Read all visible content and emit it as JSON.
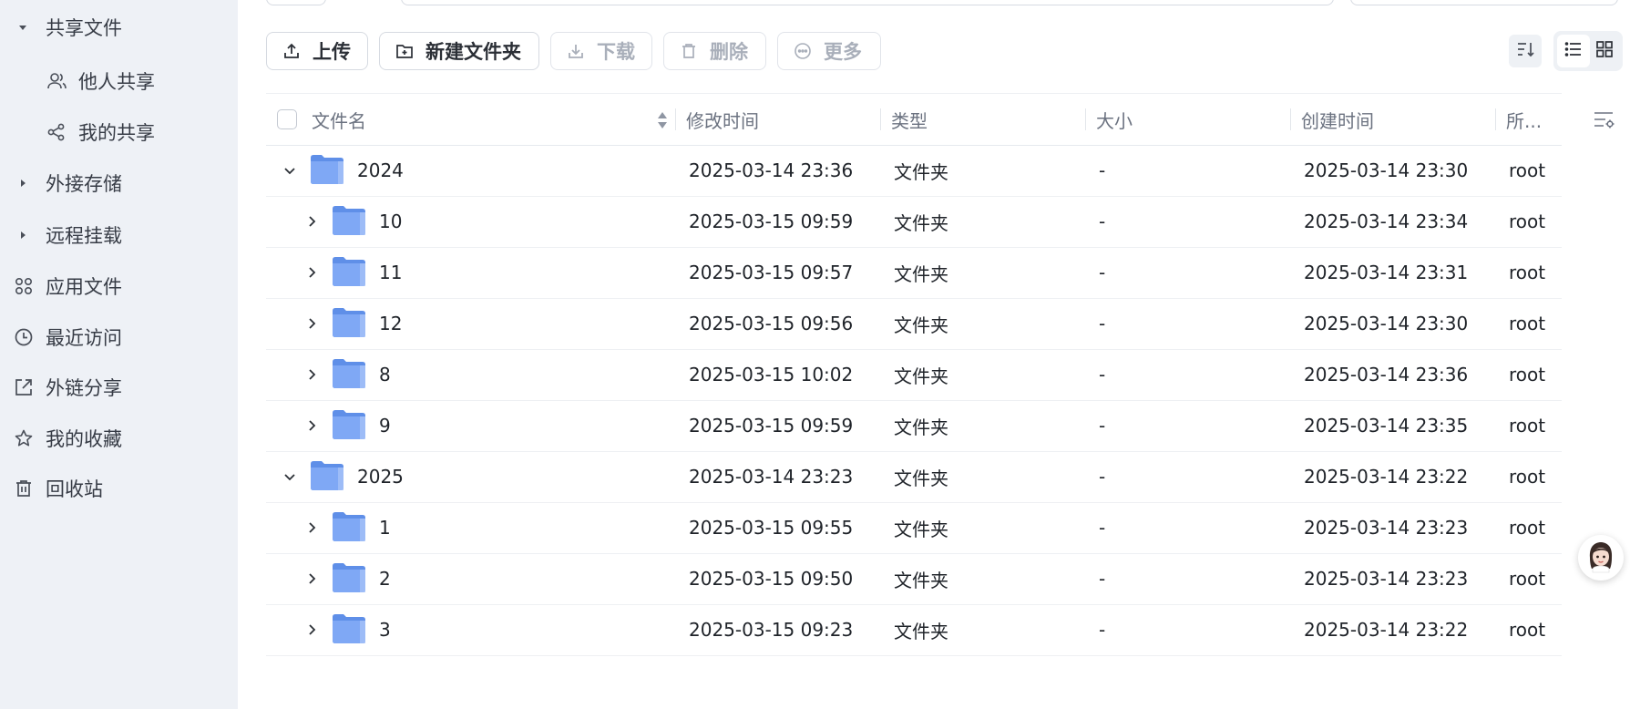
{
  "sidebar": {
    "items": [
      {
        "label": "共享文件",
        "kind": "group-open"
      },
      {
        "label": "他人共享",
        "kind": "sub",
        "icon": "users-icon"
      },
      {
        "label": "我的共享",
        "kind": "sub",
        "icon": "share-icon"
      },
      {
        "label": "外接存储",
        "kind": "group-closed"
      },
      {
        "label": "远程挂载",
        "kind": "group-closed"
      },
      {
        "label": "应用文件",
        "kind": "item",
        "icon": "apps-icon"
      },
      {
        "label": "最近访问",
        "kind": "item",
        "icon": "clock-icon"
      },
      {
        "label": "外链分享",
        "kind": "item",
        "icon": "external-link-icon"
      },
      {
        "label": "我的收藏",
        "kind": "item",
        "icon": "star-icon"
      },
      {
        "label": "回收站",
        "kind": "item",
        "icon": "trash-icon"
      }
    ]
  },
  "toolbar": {
    "upload": "上传",
    "new_folder": "新建文件夹",
    "download": "下载",
    "delete": "删除",
    "more": "更多"
  },
  "table": {
    "headers": {
      "name": "文件名",
      "modified": "修改时间",
      "type": "类型",
      "size": "大小",
      "created": "创建时间",
      "owner": "所..."
    },
    "rows": [
      {
        "level": 0,
        "expanded": true,
        "name": "2024",
        "modified": "2025-03-14 23:36",
        "type": "文件夹",
        "size": "-",
        "created": "2025-03-14 23:30",
        "owner": "root"
      },
      {
        "level": 1,
        "expanded": false,
        "name": "10",
        "modified": "2025-03-15 09:59",
        "type": "文件夹",
        "size": "-",
        "created": "2025-03-14 23:34",
        "owner": "root"
      },
      {
        "level": 1,
        "expanded": false,
        "name": "11",
        "modified": "2025-03-15 09:57",
        "type": "文件夹",
        "size": "-",
        "created": "2025-03-14 23:31",
        "owner": "root"
      },
      {
        "level": 1,
        "expanded": false,
        "name": "12",
        "modified": "2025-03-15 09:56",
        "type": "文件夹",
        "size": "-",
        "created": "2025-03-14 23:30",
        "owner": "root"
      },
      {
        "level": 1,
        "expanded": false,
        "name": "8",
        "modified": "2025-03-15 10:02",
        "type": "文件夹",
        "size": "-",
        "created": "2025-03-14 23:36",
        "owner": "root"
      },
      {
        "level": 1,
        "expanded": false,
        "name": "9",
        "modified": "2025-03-15 09:59",
        "type": "文件夹",
        "size": "-",
        "created": "2025-03-14 23:35",
        "owner": "root"
      },
      {
        "level": 0,
        "expanded": true,
        "name": "2025",
        "modified": "2025-03-14 23:23",
        "type": "文件夹",
        "size": "-",
        "created": "2025-03-14 23:22",
        "owner": "root"
      },
      {
        "level": 1,
        "expanded": false,
        "name": "1",
        "modified": "2025-03-15 09:55",
        "type": "文件夹",
        "size": "-",
        "created": "2025-03-14 23:23",
        "owner": "root"
      },
      {
        "level": 1,
        "expanded": false,
        "name": "2",
        "modified": "2025-03-15 09:50",
        "type": "文件夹",
        "size": "-",
        "created": "2025-03-14 23:23",
        "owner": "root"
      },
      {
        "level": 1,
        "expanded": false,
        "name": "3",
        "modified": "2025-03-15 09:23",
        "type": "文件夹",
        "size": "-",
        "created": "2025-03-14 23:22",
        "owner": "root"
      }
    ]
  },
  "colors": {
    "sidebar_bg": "#eef1f6",
    "folder": "#7fa8f5",
    "border": "#d6dae1",
    "disabled": "#a9afba"
  }
}
